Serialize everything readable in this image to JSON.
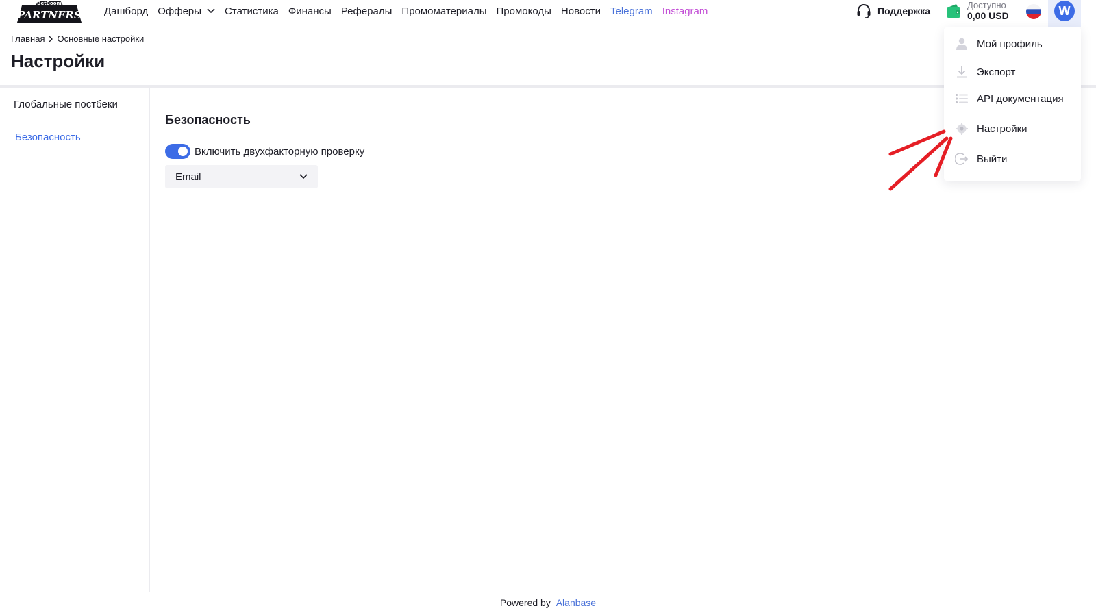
{
  "header": {
    "logo_top": "BetBoom",
    "logo_main": "PARTNERS",
    "nav": [
      {
        "label": "Дашборд"
      },
      {
        "label": "Офферы"
      },
      {
        "label": "Статистика"
      },
      {
        "label": "Финансы"
      },
      {
        "label": "Рефералы"
      },
      {
        "label": "Промоматериалы"
      },
      {
        "label": "Промокоды"
      },
      {
        "label": "Новости"
      },
      {
        "label": "Telegram"
      },
      {
        "label": "Instagram"
      }
    ],
    "support_label": "Поддержка",
    "balance_label": "Доступно",
    "balance_value": "0,00 USD",
    "avatar_letter": "W",
    "colors": {
      "accent": "#3d6ce6",
      "telegram": "#4a72d9",
      "instagram": "#c34fd6",
      "wallet": "#27c27a"
    }
  },
  "breadcrumb": {
    "home": "Главная",
    "current": "Основные настройки"
  },
  "page_title": "Настройки",
  "sidebar": {
    "items": [
      {
        "label": "Глобальные постбеки",
        "active": false
      },
      {
        "label": "Безопасность",
        "active": true
      }
    ]
  },
  "security": {
    "title": "Безопасность",
    "two_factor_label": "Включить двухфакторную проверку",
    "two_factor_enabled": true,
    "method_value": "Email"
  },
  "user_menu": {
    "items": [
      {
        "label": "Мой профиль",
        "icon": "user-icon"
      },
      {
        "label": "Экспорт",
        "icon": "download-icon"
      },
      {
        "label": "API документация",
        "icon": "list-icon"
      },
      {
        "label": "Настройки",
        "icon": "gear-icon"
      },
      {
        "label": "Выйти",
        "icon": "logout-icon"
      }
    ]
  },
  "footer": {
    "powered_by": "Powered by",
    "brand": "Alanbase"
  }
}
